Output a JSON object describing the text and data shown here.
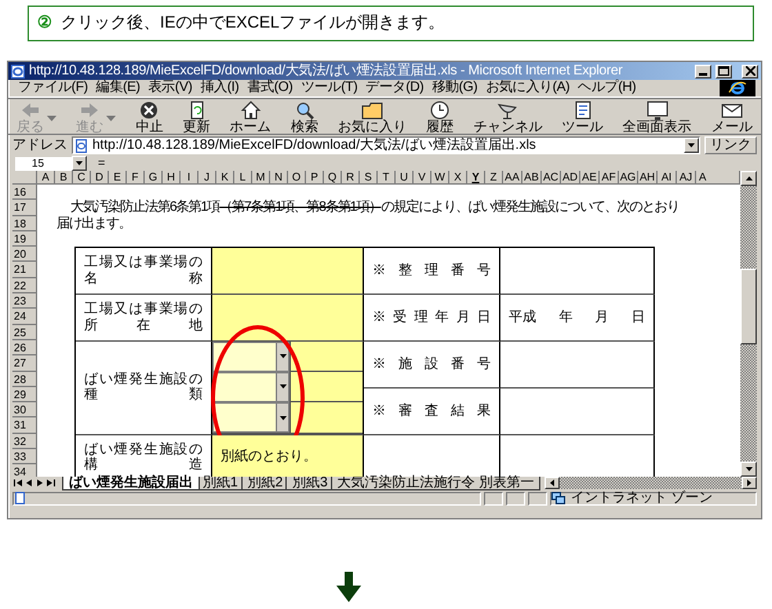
{
  "caption": {
    "number": "②",
    "text": "クリック後、IEの中でEXCELファイルが開きます。"
  },
  "window": {
    "title": "http://10.48.128.189/MieExcelFD/download/大気法/ばい煙法設置届出.xls - Microsoft Internet Explorer",
    "menu": [
      "ファイル(F)",
      "編集(E)",
      "表示(V)",
      "挿入(I)",
      "書式(O)",
      "ツール(T)",
      "データ(D)",
      "移動(G)",
      "お気に入り(A)",
      "ヘルプ(H)"
    ],
    "toolbar": [
      {
        "label": "戻る",
        "kind": "back",
        "disabled": true,
        "dropdown": true
      },
      {
        "label": "進む",
        "kind": "forward",
        "disabled": true,
        "dropdown": true
      },
      {
        "label": "中止",
        "kind": "stop",
        "disabled": false,
        "dropdown": false
      },
      {
        "label": "更新",
        "kind": "refresh",
        "disabled": false,
        "dropdown": false
      },
      {
        "label": "ホーム",
        "kind": "home",
        "disabled": false,
        "dropdown": false
      },
      {
        "label": "検索",
        "kind": "search",
        "disabled": false,
        "dropdown": false
      },
      {
        "label": "お気に入り",
        "kind": "favorites",
        "disabled": false,
        "dropdown": false
      },
      {
        "label": "履歴",
        "kind": "history",
        "disabled": false,
        "dropdown": false
      },
      {
        "label": "チャンネル",
        "kind": "channel",
        "disabled": false,
        "dropdown": false
      },
      {
        "label": "ツール",
        "kind": "tools",
        "disabled": false,
        "dropdown": false
      },
      {
        "label": "全画面表示",
        "kind": "fullscreen",
        "disabled": false,
        "dropdown": false
      },
      {
        "label": "メール",
        "kind": "mail",
        "disabled": false,
        "dropdown": false
      }
    ],
    "address": {
      "label": "アドレス",
      "url": "http://10.48.128.189/MieExcelFD/download/大気法/ばい煙法設置届出.xls",
      "links": "リンク"
    }
  },
  "sheet": {
    "name_box": "15",
    "formula_button": "=",
    "columns": [
      {
        "label": "A",
        "selected": false
      },
      {
        "label": "B",
        "selected": false
      },
      {
        "label": "C",
        "selected": false
      },
      {
        "label": "D",
        "selected": false
      },
      {
        "label": "E",
        "selected": false
      },
      {
        "label": "F",
        "selected": false
      },
      {
        "label": "G",
        "selected": false
      },
      {
        "label": "H",
        "selected": false
      },
      {
        "label": "I",
        "selected": false
      },
      {
        "label": "J",
        "selected": false
      },
      {
        "label": "K",
        "selected": false
      },
      {
        "label": "L",
        "selected": false
      },
      {
        "label": "M",
        "selected": false
      },
      {
        "label": "N",
        "selected": false
      },
      {
        "label": "O",
        "selected": false
      },
      {
        "label": "P",
        "selected": false
      },
      {
        "label": "Q",
        "selected": false
      },
      {
        "label": "R",
        "selected": false
      },
      {
        "label": "S",
        "selected": false
      },
      {
        "label": "T",
        "selected": false
      },
      {
        "label": "U",
        "selected": false
      },
      {
        "label": "V",
        "selected": false
      },
      {
        "label": "W",
        "selected": false
      },
      {
        "label": "X",
        "selected": false
      },
      {
        "label": "Y",
        "selected": true
      },
      {
        "label": "Z",
        "selected": false
      },
      {
        "label": "AA",
        "selected": false
      },
      {
        "label": "AB",
        "selected": false
      },
      {
        "label": "AC",
        "selected": false
      },
      {
        "label": "AD",
        "selected": false
      },
      {
        "label": "AE",
        "selected": false
      },
      {
        "label": "AF",
        "selected": false
      },
      {
        "label": "AG",
        "selected": false
      },
      {
        "label": "AH",
        "selected": false
      },
      {
        "label": "AI",
        "selected": false
      },
      {
        "label": "AJ",
        "selected": false
      },
      {
        "label": "A",
        "selected": false
      }
    ],
    "rows": [
      "16",
      "17",
      "18",
      "19",
      "20",
      "21",
      "22",
      "23",
      "24",
      "25",
      "26",
      "27",
      "28",
      "29",
      "30",
      "31",
      "32",
      "33",
      "34"
    ],
    "lines": [
      {
        "segments": [
          {
            "text": "大気汚染防止法第6条第1項",
            "struck": false
          },
          {
            "text": "（第7条第1項、第8条第1項）",
            "struck": true
          },
          {
            "text": "の規定により、ばい煙発生施設について、次のとおり",
            "struck": false
          }
        ]
      },
      {
        "segments": [
          {
            "text": "届け出ます。",
            "struck": false
          }
        ]
      }
    ],
    "form": {
      "name_label": "工場又は事業場の名称",
      "address_label": "工場又は事業場の所在地",
      "type_label": "ばい煙発生施設の種類",
      "structure_label": "ばい煙発生施設の構造",
      "structure_value": "別紙のとおり。",
      "dropdowns": [
        {
          "kind": "combo"
        },
        {
          "kind": "combo"
        },
        {
          "kind": "combo"
        }
      ],
      "office_labels": [
        "※整理番号",
        "※受理年月日",
        "※施設番号",
        "※審査結果"
      ],
      "receipt_date": [
        "平成",
        "年",
        "月",
        "日"
      ]
    },
    "tabs": [
      {
        "label": "ばい煙発生施設届出",
        "selected": true
      },
      {
        "label": "別紙1",
        "selected": false
      },
      {
        "label": "別紙2",
        "selected": false
      },
      {
        "label": "別紙3",
        "selected": false
      },
      {
        "label": "大気汚染防止法施行令 別表第一",
        "selected": false
      }
    ]
  },
  "status_bar": {
    "zone": "イントラネット ゾーン"
  }
}
